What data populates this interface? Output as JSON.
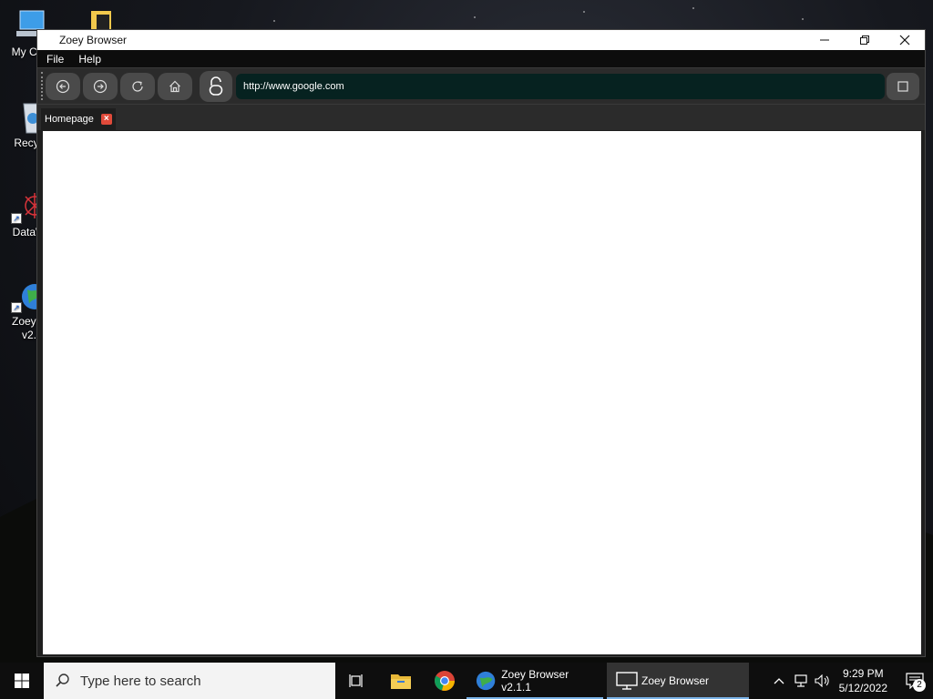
{
  "desktop": {
    "icons": [
      {
        "label": "My Cor",
        "icon": "computer-icon"
      },
      {
        "label": "Recyc",
        "icon": "recycle-bin-icon"
      },
      {
        "label": "DataW",
        "icon": "datawrapper-icon"
      },
      {
        "label": "Zoey B",
        "label2": "v2.",
        "icon": "globe-icon"
      }
    ],
    "folder_icon": "folder-icon"
  },
  "window": {
    "title": "Zoey Browser",
    "minimize_icon": "minimize-icon",
    "restore_icon": "restore-icon",
    "close_icon": "close-icon",
    "menu": [
      "File",
      "Help"
    ],
    "toolbar": {
      "back_icon": "back-arrow-icon",
      "forward_icon": "forward-arrow-icon",
      "refresh_icon": "refresh-icon",
      "home_icon": "home-icon",
      "lock_icon": "unlock-icon",
      "url": "http://www.google.com",
      "go_icon": "square-icon"
    },
    "tabs": [
      {
        "label": "Homepage",
        "close_icon": "tab-close-icon"
      }
    ]
  },
  "taskbar": {
    "search_placeholder": "Type here to search",
    "apps": [
      {
        "label": "Zoey Browser v2.1.1",
        "icon": "globe-icon"
      },
      {
        "label": "Zoey Browser",
        "icon": "monitor-icon"
      }
    ],
    "clock": {
      "time": "9:29 PM",
      "date": "5/12/2022"
    },
    "notifications_count": "2"
  }
}
